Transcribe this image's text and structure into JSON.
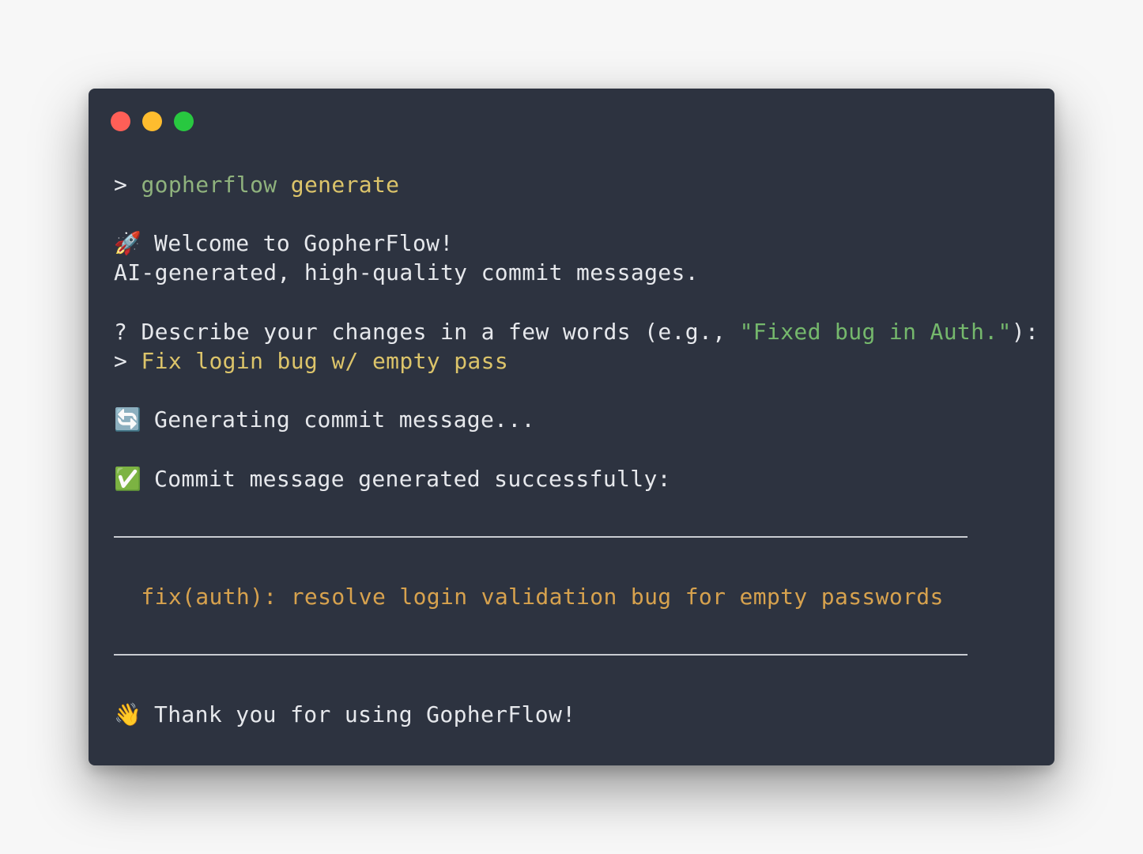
{
  "window": {
    "controls": [
      "close",
      "minimize",
      "maximize"
    ],
    "colors": {
      "background": "#2d3340",
      "close": "#ff5f57",
      "minimize": "#febc2e",
      "maximize": "#28c840"
    }
  },
  "terminal": {
    "command_prompt": ">",
    "command": "gopherflow",
    "subcommand": "generate",
    "welcome_icon": "rocket-emoji",
    "welcome_text": "Welcome to GopherFlow!",
    "tagline": "AI-generated, high-quality commit messages.",
    "question_prefix": "?",
    "question_text": "Describe your changes in a few words (e.g., ",
    "question_example": "\"Fixed bug in Auth.\"",
    "question_suffix": "):",
    "answer_prompt": ">",
    "answer_text": "Fix login bug w/ empty pass",
    "generating_icon": "arrows-cycle-emoji",
    "generating_text": "Generating commit message...",
    "success_icon": "check-mark-emoji",
    "success_text": "Commit message generated successfully:",
    "commit_message": "fix(auth): resolve login validation bug for empty passwords",
    "farewell_icon": "waving-hand-emoji",
    "farewell_text": "Thank you for using GopherFlow!"
  },
  "colors": {
    "text": "#e6e8ec",
    "command": "#8fb27d",
    "argument": "#dcc46a",
    "example": "#75b86c",
    "commit": "#d7a24e"
  }
}
